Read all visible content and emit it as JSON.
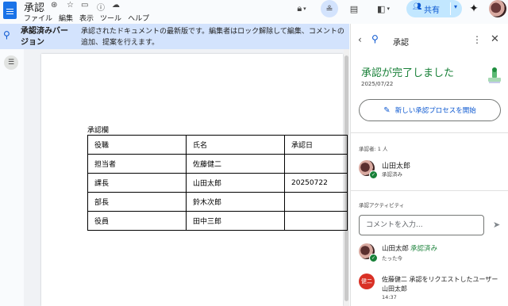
{
  "app": {
    "doc_title": "承認",
    "menu": [
      "ファイル",
      "編集",
      "表示",
      "ツール",
      "ヘルプ"
    ],
    "share_label": "共有"
  },
  "banner": {
    "title": "承認済みバージョン",
    "text": "承認されたドキュメントの最新版です。編集者はロック解除して編集、コメントの追加、提案を行えます。"
  },
  "document": {
    "table_caption": "承認欄",
    "table": {
      "rows": [
        [
          "役職",
          "氏名",
          "承認日"
        ],
        [
          "担当者",
          "佐藤健二",
          ""
        ],
        [
          "課長",
          "山田太郎",
          "20250722"
        ],
        [
          "部長",
          "鈴木次郎",
          ""
        ],
        [
          "役員",
          "田中三郎",
          ""
        ]
      ]
    }
  },
  "panel": {
    "title": "承認",
    "complete_title": "承認が完了しました",
    "complete_date": "2025/07/22",
    "new_process_label": "新しい承認プロセスを開始",
    "approvers_label": "承認者: 1 人",
    "approver": {
      "name": "山田太郎",
      "status": "承認済み"
    },
    "activity_label": "承認アクティビティ",
    "comment_placeholder": "コメントを入力...",
    "activities": [
      {
        "name": "山田太郎",
        "action": "承認済み",
        "time": "たった今"
      },
      {
        "avatar_text": "健二",
        "text": "佐藤健二 承認をリクエストしたユーザー 山田太郎",
        "time": "14:37"
      }
    ]
  },
  "colors": {
    "accent": "#0b57d0",
    "success": "#188038",
    "banner": "#d3e3fd"
  }
}
